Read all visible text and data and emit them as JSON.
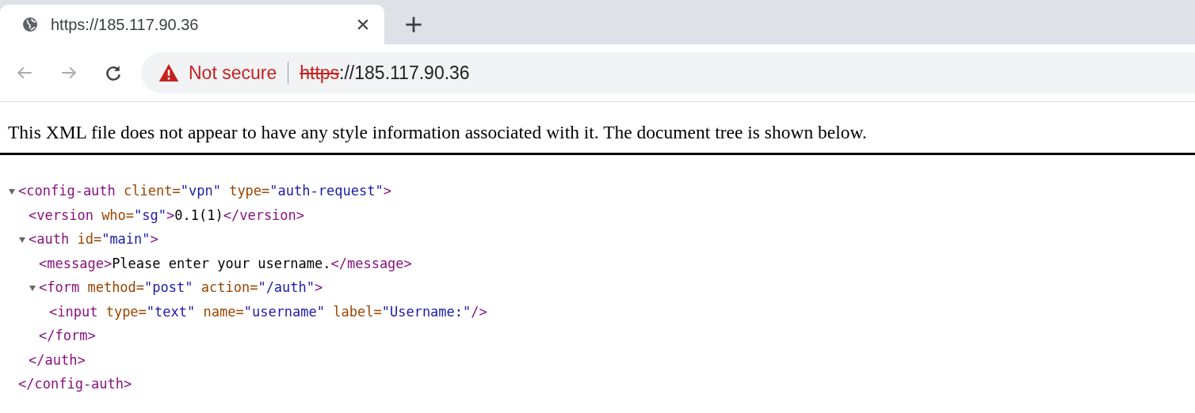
{
  "tab": {
    "title": "https://185.117.90.36",
    "selected": true
  },
  "address_bar": {
    "secure": false,
    "security_label": "Not secure",
    "scheme": "https",
    "rest": "://185.117.90.36"
  },
  "page": {
    "notice": "This XML file does not appear to have any style information associated with it. The document tree is shown below.",
    "tree": [
      {
        "expanded": true,
        "line": [
          {
            "kind": "tag",
            "text": "<config-auth"
          },
          {
            "kind": "attr_name",
            "text": "client="
          },
          {
            "kind": "attr_value",
            "text": "\"vpn\""
          },
          {
            "kind": "attr_name",
            "text": "type="
          },
          {
            "kind": "attr_value",
            "text": "\"auth-request\""
          },
          {
            "kind": "tag_end",
            "text": ">"
          }
        ],
        "closing": [
          {
            "kind": "tag",
            "text": "</config-auth>"
          }
        ],
        "children": [
          {
            "line": [
              {
                "kind": "tag",
                "text": "<version"
              },
              {
                "kind": "attr_name",
                "text": "who="
              },
              {
                "kind": "attr_value",
                "text": "\"sg\""
              },
              {
                "kind": "tag_end",
                "text": ">"
              },
              {
                "kind": "text",
                "text": "0.1(1)"
              },
              {
                "kind": "tag_end",
                "text": "</version>"
              }
            ]
          },
          {
            "expanded": true,
            "line": [
              {
                "kind": "tag",
                "text": "<auth"
              },
              {
                "kind": "attr_name",
                "text": "id="
              },
              {
                "kind": "attr_value",
                "text": "\"main\""
              },
              {
                "kind": "tag_end",
                "text": ">"
              }
            ],
            "closing": [
              {
                "kind": "tag",
                "text": "</auth>"
              }
            ],
            "children": [
              {
                "line": [
                  {
                    "kind": "tag",
                    "text": "<message>"
                  },
                  {
                    "kind": "text",
                    "text": "Please enter your username."
                  },
                  {
                    "kind": "tag_end",
                    "text": "</message>"
                  }
                ]
              },
              {
                "expanded": true,
                "line": [
                  {
                    "kind": "tag",
                    "text": "<form"
                  },
                  {
                    "kind": "attr_name",
                    "text": "method="
                  },
                  {
                    "kind": "attr_value",
                    "text": "\"post\""
                  },
                  {
                    "kind": "attr_name",
                    "text": "action="
                  },
                  {
                    "kind": "attr_value",
                    "text": "\"/auth\""
                  },
                  {
                    "kind": "tag_end",
                    "text": ">"
                  }
                ],
                "closing": [
                  {
                    "kind": "tag",
                    "text": "</form>"
                  }
                ],
                "children": [
                  {
                    "line": [
                      {
                        "kind": "tag",
                        "text": "<input"
                      },
                      {
                        "kind": "attr_name",
                        "text": "type="
                      },
                      {
                        "kind": "attr_value",
                        "text": "\"text\""
                      },
                      {
                        "kind": "attr_name",
                        "text": "name="
                      },
                      {
                        "kind": "attr_value",
                        "text": "\"username\""
                      },
                      {
                        "kind": "attr_name",
                        "text": "label="
                      },
                      {
                        "kind": "attr_value",
                        "text": "\"Username:\""
                      },
                      {
                        "kind": "tag_end",
                        "text": "/>"
                      }
                    ]
                  }
                ]
              }
            ]
          }
        ]
      }
    ]
  }
}
